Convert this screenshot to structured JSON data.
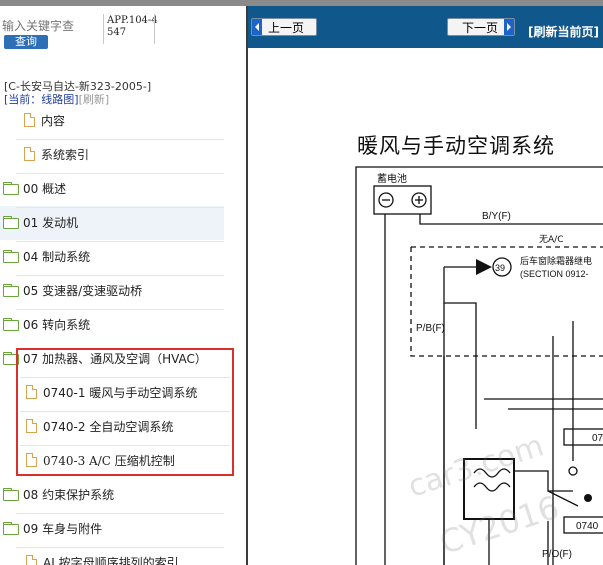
{
  "search": {
    "placeholder": "输入关键字查",
    "button_label": "查询"
  },
  "app_code": "APP.104-4547",
  "doc_code": "[C-长安马自达-新323-2005-]",
  "current": {
    "label": "[当前：线路图]",
    "refresh": "[刷新]"
  },
  "tree": [
    {
      "kind": "page",
      "label": "内容"
    },
    {
      "kind": "page",
      "label": "系统索引"
    },
    {
      "kind": "folder",
      "label": "00 概述"
    },
    {
      "kind": "folder",
      "label": "01 发动机"
    },
    {
      "kind": "folder",
      "label": "04 制动系统"
    },
    {
      "kind": "folder",
      "label": "05 变速器/变速驱动桥"
    },
    {
      "kind": "folder",
      "label": "06 转向系统"
    },
    {
      "kind": "folder",
      "label": "07 加热器、通风及空调（HVAC）"
    },
    {
      "kind": "page",
      "label": "0740-1 暖风与手动空调系统"
    },
    {
      "kind": "page",
      "label": "0740-2 全自动空调系统"
    },
    {
      "kind": "page",
      "label": "0740-3 A/C 压缩机控制"
    },
    {
      "kind": "folder",
      "label": "08 约束保护系统"
    },
    {
      "kind": "folder",
      "label": "09 车身与附件"
    },
    {
      "kind": "page",
      "label": "AI 按字母顺序排列的索引"
    }
  ],
  "toolbar": {
    "prev": "上一页",
    "next": "下一页",
    "refresh": "[刷新当前页]"
  },
  "doc": {
    "title": "暖风与手动空调系统"
  },
  "diagram": {
    "battery": "蓄电池",
    "battery_wire": "B/Y(F)",
    "no_ac": "无A/C",
    "connector_num": "39",
    "relay_label": "后车窗除霜器继电",
    "relay_ref": "(SECTION 0912-",
    "pb_wire": "P/B(F)",
    "po_wire": "P/O(F)",
    "box1": "07",
    "box2": "0740"
  },
  "watermark": {
    "line1": "car3.com",
    "line2": "CY2016"
  },
  "colors": {
    "toolbar": "#10588b",
    "highlight": "#d9302c",
    "query_btn": "#2f6fb5"
  }
}
